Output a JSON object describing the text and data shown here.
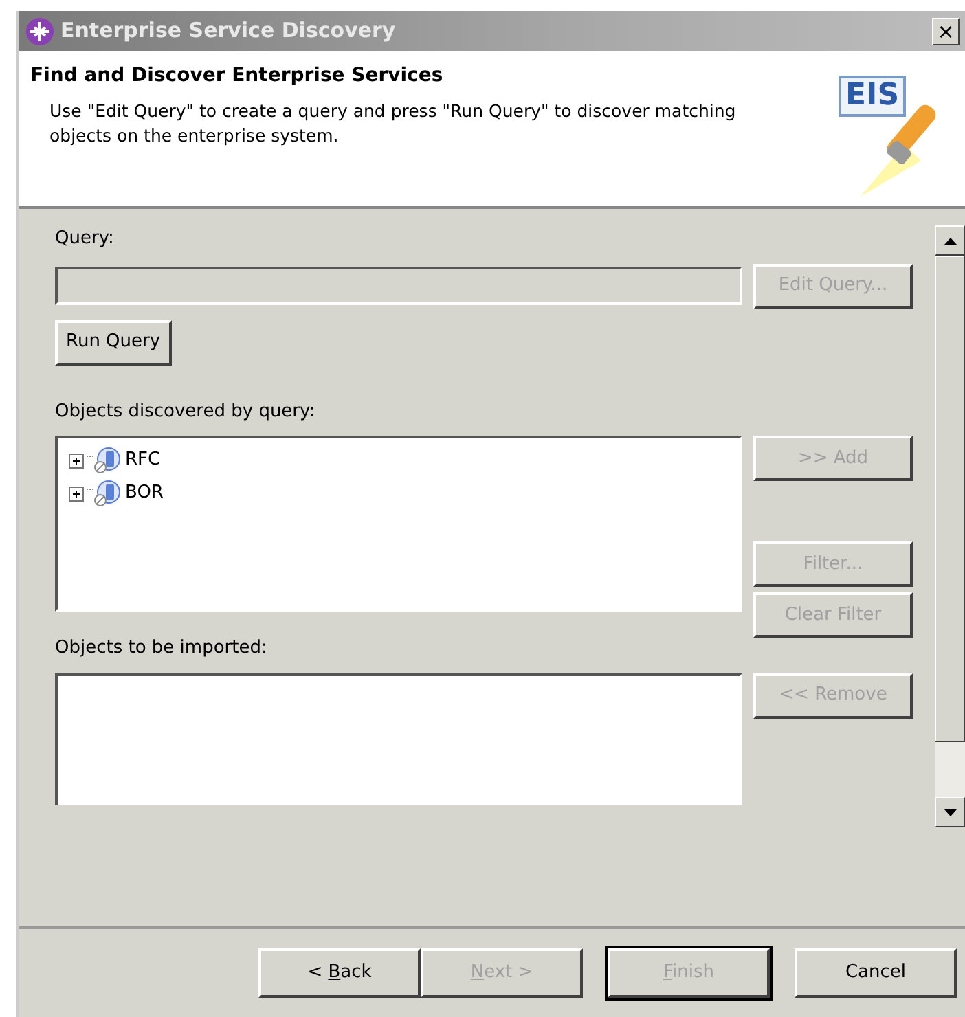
{
  "window": {
    "title": "Enterprise Service Discovery",
    "close": "×"
  },
  "header": {
    "title": "Find and Discover Enterprise Services",
    "description": "Use \"Edit Query\" to create a query and press \"Run Query\" to discover matching objects on the enterprise system.",
    "logo_text": "EIS"
  },
  "query": {
    "label": "Query:",
    "disabled": true,
    "edit_button": {
      "label": "Edit Query...",
      "disabled": true
    },
    "run_button": {
      "label": "Run Query",
      "disabled": false
    }
  },
  "discovered": {
    "label": "Objects discovered by query:",
    "items": [
      {
        "label": "RFC",
        "expanded": false
      },
      {
        "label": "BOR",
        "expanded": false
      }
    ],
    "buttons": [
      {
        "label": ">> Add",
        "disabled": true
      },
      {
        "label": "Filter...",
        "disabled": true
      },
      {
        "label": "Clear Filter",
        "disabled": true
      }
    ]
  },
  "imported": {
    "label": "Objects to be imported:",
    "buttons": [
      {
        "label": "<< Remove",
        "disabled": true
      }
    ]
  },
  "footer_buttons": [
    {
      "before": "< ",
      "mnemonic": "B",
      "after": "ack",
      "disabled": false,
      "default": false
    },
    {
      "mnemonic": "N",
      "after": "ext >",
      "disabled": true,
      "default": false
    },
    {
      "mnemonic": "F",
      "after": "inish",
      "disabled": true,
      "default": true
    },
    {
      "label": "Cancel",
      "disabled": false,
      "default": false
    }
  ]
}
